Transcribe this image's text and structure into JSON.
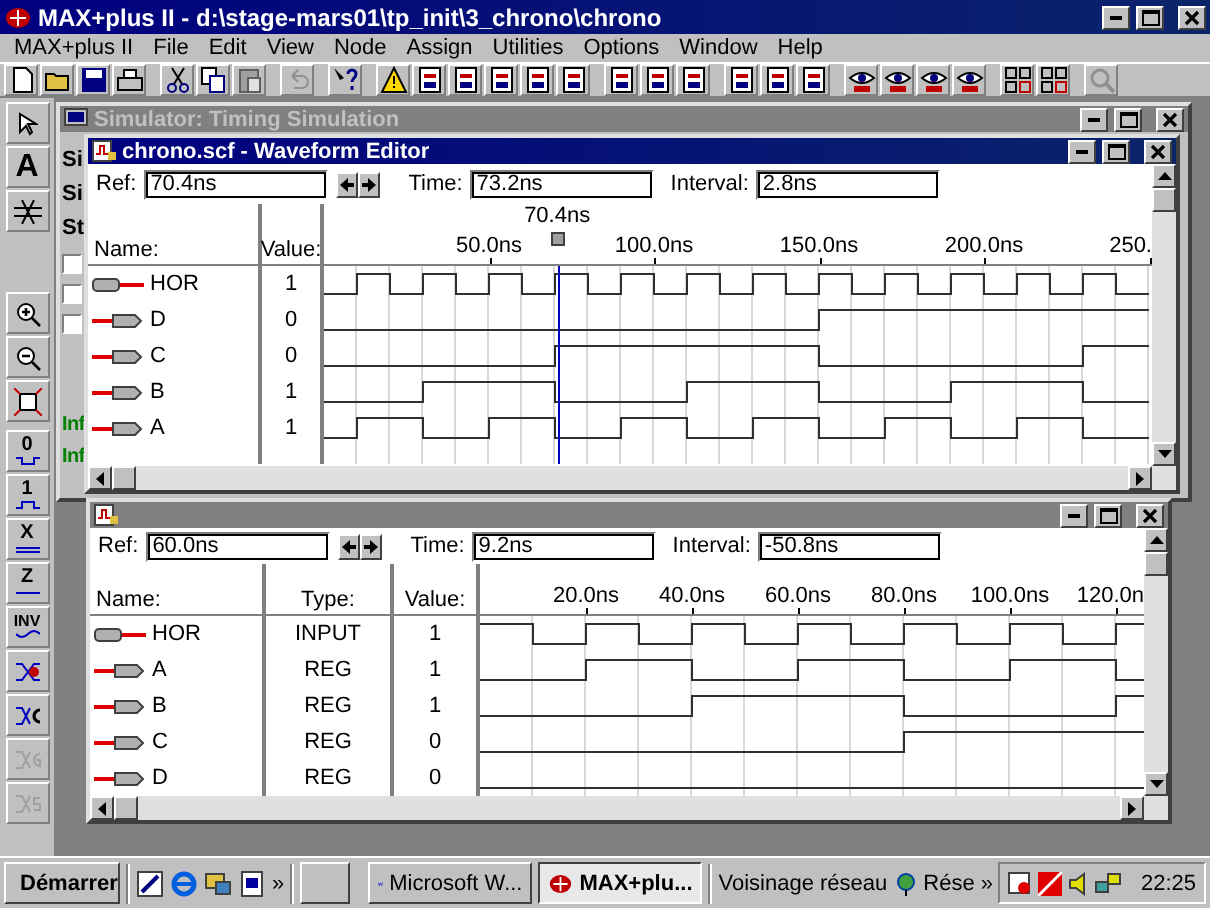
{
  "window": {
    "title": "MAX+plus II - d:\\stage-mars01\\tp_init\\3_chrono\\chrono"
  },
  "menu": [
    "MAX+plus II",
    "File",
    "Edit",
    "View",
    "Node",
    "Assign",
    "Utilities",
    "Options",
    "Window",
    "Help"
  ],
  "palette": {
    "text_tool": "A",
    "levels": [
      "0",
      "1",
      "X",
      "Z",
      "INV"
    ]
  },
  "simulator": {
    "title": "Simulator: Timing Simulation",
    "active": false,
    "labels": [
      "Si",
      "Si",
      "St"
    ],
    "checkboxes": [
      {
        "checked": false
      },
      {
        "checked": false
      },
      {
        "checked": false
      }
    ],
    "messages": [
      "Inf",
      "Inf"
    ]
  },
  "editors": [
    {
      "title": "chrono.scf - Waveform Editor",
      "active": true,
      "ref_label": "Ref:",
      "ref": "70.4ns",
      "time_label": "Time:",
      "time": "73.2ns",
      "interval_label": "Interval:",
      "interval": "2.8ns",
      "cursor": {
        "label": "70.4ns",
        "level": 0.2816
      },
      "columns": [
        "Name:",
        "Value:"
      ],
      "ticks": [
        "50.0ns",
        "100.0ns",
        "150.0ns",
        "200.0ns",
        "250."
      ],
      "signals": [
        {
          "name": "HOR",
          "kind": "input",
          "value": "1"
        },
        {
          "name": "D",
          "kind": "output",
          "value": "0"
        },
        {
          "name": "C",
          "kind": "output",
          "value": "0"
        },
        {
          "name": "B",
          "kind": "output",
          "value": "1"
        },
        {
          "name": "A",
          "kind": "output",
          "value": "1"
        }
      ]
    },
    {
      "active": false,
      "ref_label": "Ref:",
      "ref": "60.0ns",
      "time_label": "Time:",
      "time": "9.2ns",
      "interval_label": "Interval:",
      "interval": "-50.8ns",
      "columns": [
        "Name:",
        "Type:",
        "Value:"
      ],
      "ticks": [
        "20.0ns",
        "40.0ns",
        "60.0ns",
        "80.0ns",
        "100.0ns",
        "120.0n"
      ],
      "signals": [
        {
          "name": "HOR",
          "kind": "input",
          "type": "INPUT",
          "value": "1"
        },
        {
          "name": "A",
          "kind": "output",
          "type": "REG",
          "value": "1"
        },
        {
          "name": "B",
          "kind": "output",
          "type": "REG",
          "value": "1"
        },
        {
          "name": "C",
          "kind": "output",
          "type": "REG",
          "value": "0"
        },
        {
          "name": "D",
          "kind": "output",
          "type": "REG",
          "value": "0"
        }
      ]
    }
  ],
  "taskbar": {
    "start": "Démarrer",
    "more": "»",
    "tasks": [
      {
        "selected": false
      },
      {
        "label": "Microsoft W...",
        "selected": false
      },
      {
        "label": "MAX+plu...",
        "selected": true
      }
    ],
    "toolbar_label": "Voisinage réseau",
    "network": "Rése",
    "more_2": "»",
    "clock": "22:25"
  }
}
